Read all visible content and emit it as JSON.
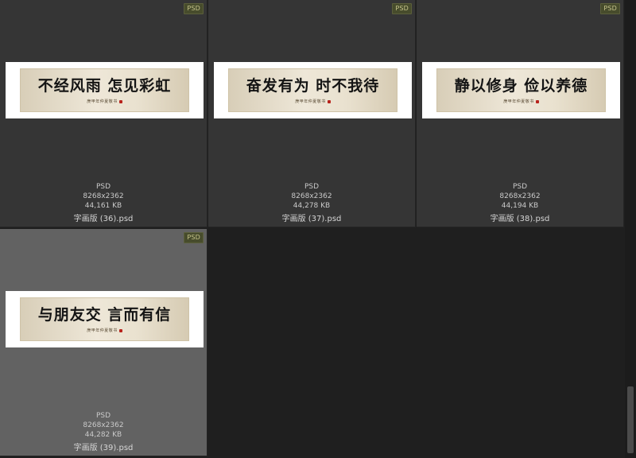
{
  "files": [
    {
      "badge": "PSD",
      "calligraphy": "不经风雨 怎见彩虹",
      "signature": "庚甲年仲夏敬书",
      "type": "PSD",
      "dimensions": "8268x2362",
      "size": "44,161 KB",
      "filename": "字画版 (36).psd"
    },
    {
      "badge": "PSD",
      "calligraphy": "奋发有为 时不我待",
      "signature": "庚甲年仲夏敬书",
      "type": "PSD",
      "dimensions": "8268x2362",
      "size": "44,278 KB",
      "filename": "字画版 (37).psd"
    },
    {
      "badge": "PSD",
      "calligraphy": "静以修身 俭以养德",
      "signature": "庚甲年仲夏敬书",
      "type": "PSD",
      "dimensions": "8268x2362",
      "size": "44,194 KB",
      "filename": "字画版 (38).psd"
    },
    {
      "badge": "PSD",
      "calligraphy": "与朋友交 言而有信",
      "signature": "庚甲年仲夏敬书",
      "type": "PSD",
      "dimensions": "8268x2362",
      "size": "44,282 KB",
      "filename": "字画版 (39).psd",
      "selected": true
    }
  ]
}
